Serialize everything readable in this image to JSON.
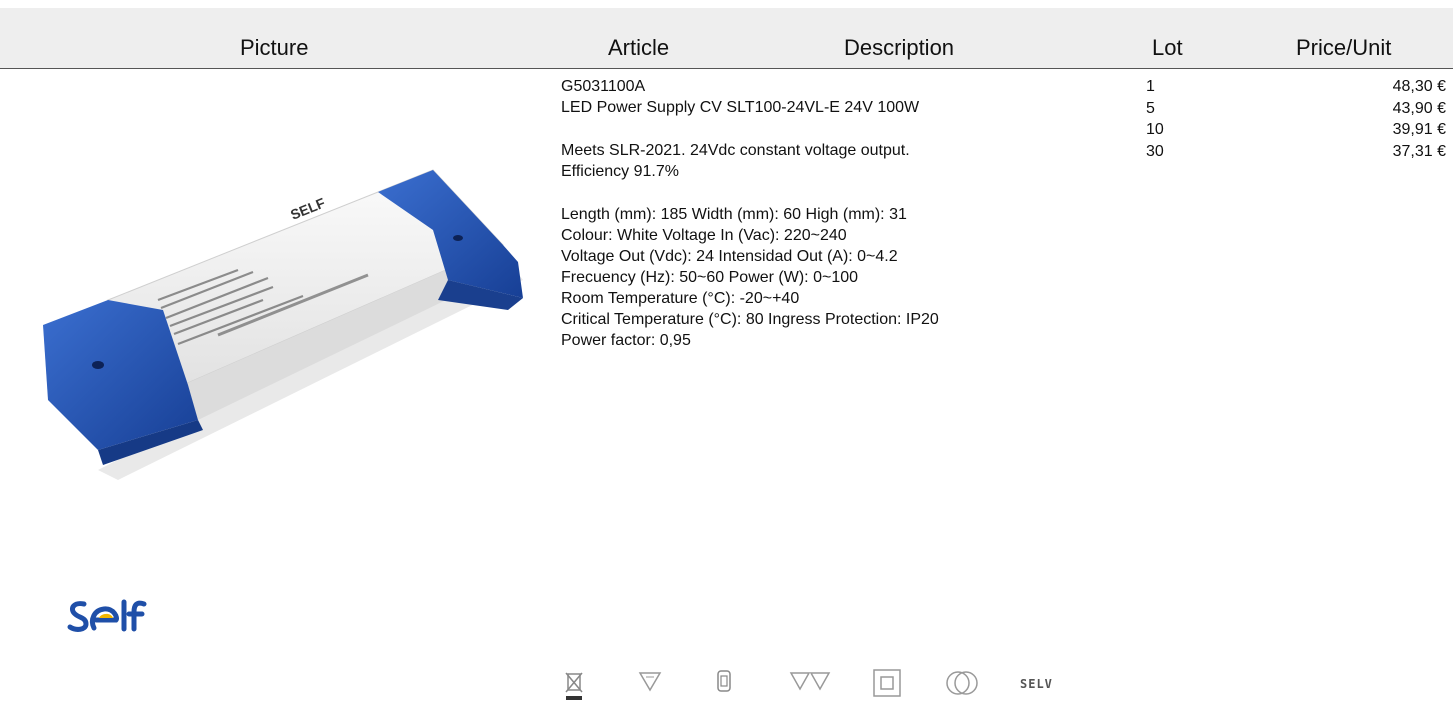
{
  "table_header": {
    "picture": "Picture",
    "article": "Article",
    "description": "Description",
    "lot": "Lot",
    "price_unit": "Price/Unit"
  },
  "product": {
    "code": "G5031100A",
    "name": "LED Power Supply CV SLT100-24VL-E 24V 100W",
    "summary_line1": "Meets SLR-2021. 24Vdc constant voltage output.",
    "summary_line2": "Efficiency 91.7%",
    "specs": [
      "Length (mm): 185 Width (mm): 60 High (mm): 31",
      "Colour: White Voltage In (Vac): 220~240",
      "Voltage Out (Vdc): 24 Intensidad Out (A): 0~4.2",
      "Frecuency (Hz): 50~60 Power (W): 0~100",
      "Room Temperature (°C): -20~+40",
      "Critical Temperature (°C): 80 Ingress Protection: IP20",
      "Power factor: 0,95"
    ]
  },
  "pricing": [
    {
      "lot": "1",
      "price": "48,30 €"
    },
    {
      "lot": "5",
      "price": "43,90 €"
    },
    {
      "lot": "10",
      "price": "39,91 €"
    },
    {
      "lot": "30",
      "price": "37,31 €"
    }
  ],
  "brand": {
    "logo_text": "SELF",
    "logo_color": "#1f4fa8"
  },
  "certifications": {
    "icons": [
      "weee-bin-icon",
      "temp-triangle-icon",
      "fuse-icon",
      "dual-triangle-icon",
      "double-insulation-icon",
      "transformer-icon"
    ],
    "selv_label": "SELV"
  },
  "colors": {
    "header_bg": "#eeeeee",
    "accent_blue": "#1e4fae",
    "housing_white": "#f3f3f3"
  }
}
